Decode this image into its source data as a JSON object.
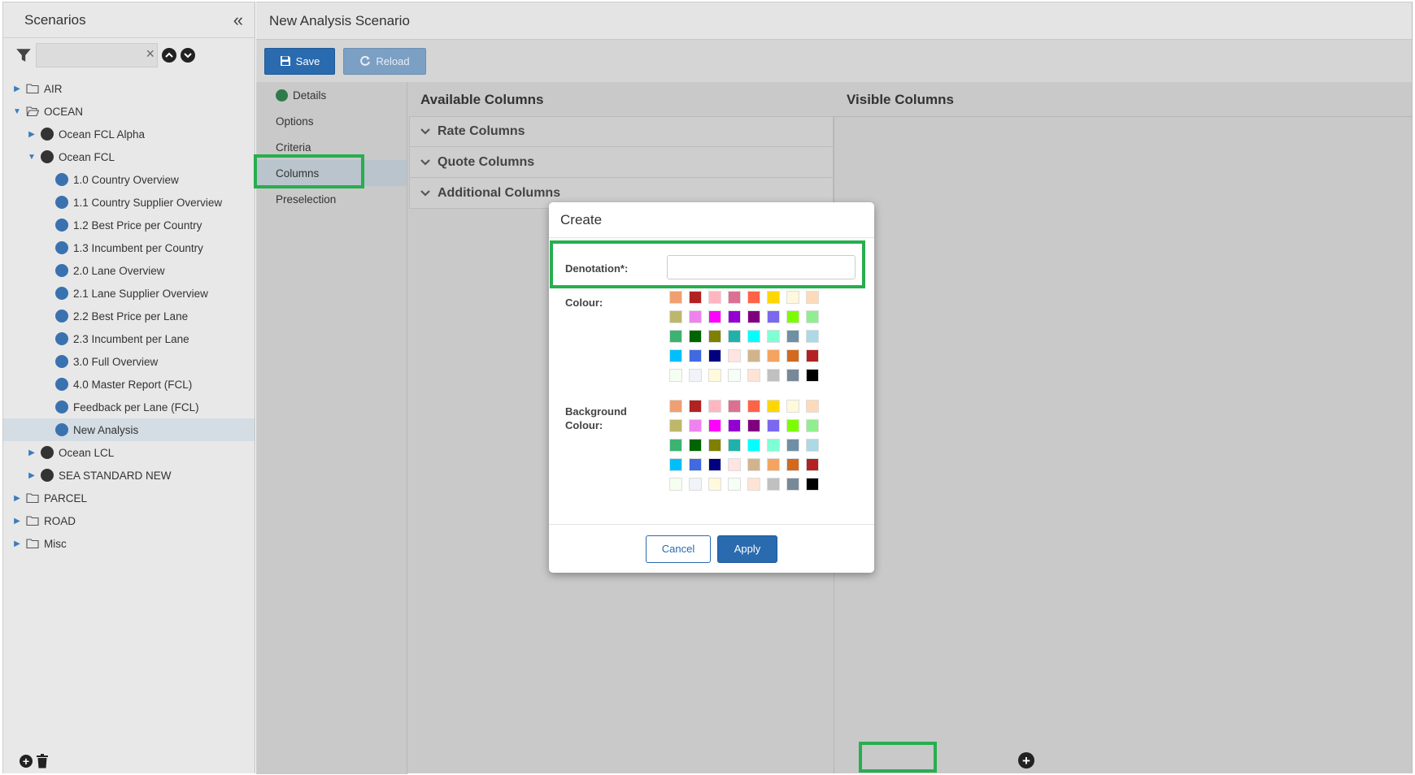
{
  "sidebar": {
    "title": "Scenarios",
    "filter_value": "",
    "tree": [
      {
        "label": "AIR",
        "level": 0,
        "kind": "folder",
        "expanded": false
      },
      {
        "label": "OCEAN",
        "level": 0,
        "kind": "folder-open",
        "expanded": true
      },
      {
        "label": "Ocean FCL Alpha",
        "level": 1,
        "kind": "dark",
        "expanded": false
      },
      {
        "label": "Ocean FCL",
        "level": 1,
        "kind": "dark",
        "expanded": true
      },
      {
        "label": "1.0 Country Overview",
        "level": 2,
        "kind": "blue"
      },
      {
        "label": "1.1 Country Supplier Overview",
        "level": 2,
        "kind": "blue"
      },
      {
        "label": "1.2 Best Price per Country",
        "level": 2,
        "kind": "blue"
      },
      {
        "label": "1.3 Incumbent per Country",
        "level": 2,
        "kind": "blue"
      },
      {
        "label": "2.0 Lane Overview",
        "level": 2,
        "kind": "blue"
      },
      {
        "label": "2.1 Lane Supplier Overview",
        "level": 2,
        "kind": "blue"
      },
      {
        "label": "2.2 Best Price per Lane",
        "level": 2,
        "kind": "blue"
      },
      {
        "label": "2.3 Incumbent per Lane",
        "level": 2,
        "kind": "blue"
      },
      {
        "label": "3.0 Full Overview",
        "level": 2,
        "kind": "blue"
      },
      {
        "label": "4.0 Master Report (FCL)",
        "level": 2,
        "kind": "blue"
      },
      {
        "label": "Feedback per Lane (FCL)",
        "level": 2,
        "kind": "blue"
      },
      {
        "label": "New Analysis",
        "level": 2,
        "kind": "blue",
        "selected": true
      },
      {
        "label": "Ocean LCL",
        "level": 1,
        "kind": "dark",
        "expanded": false
      },
      {
        "label": "SEA STANDARD NEW",
        "level": 1,
        "kind": "dark",
        "expanded": false
      },
      {
        "label": "PARCEL",
        "level": 0,
        "kind": "folder",
        "expanded": false
      },
      {
        "label": "ROAD",
        "level": 0,
        "kind": "folder",
        "expanded": false
      },
      {
        "label": "Misc",
        "level": 0,
        "kind": "folder",
        "expanded": false
      }
    ]
  },
  "main": {
    "title": "New Analysis Scenario",
    "toolbar": {
      "save_label": "Save",
      "reload_label": "Reload"
    },
    "nav": [
      "Details",
      "Options",
      "Criteria",
      "Columns",
      "Preselection"
    ],
    "active_nav": "Columns",
    "available_title": "Available Columns",
    "visible_title": "Visible Columns",
    "groups": [
      "Rate Columns",
      "Quote Columns",
      "Additional Columns"
    ]
  },
  "modal": {
    "title": "Create",
    "denotation_label": "Denotation*:",
    "denotation_value": "",
    "colour_label": "Colour:",
    "background_label_line1": "Background",
    "background_label_line2": "Colour:",
    "cancel_label": "Cancel",
    "apply_label": "Apply",
    "palette": [
      "#f0a070",
      "#b22222",
      "#ffb6c1",
      "#db7093",
      "#ff6347",
      "#ffd700",
      "#fff8dc",
      "#ffdab9",
      "#bdb76b",
      "#ee82ee",
      "#ff00ff",
      "#9400d3",
      "#800080",
      "#7b68ee",
      "#7cfc00",
      "#90ee90",
      "#3cb371",
      "#006400",
      "#808000",
      "#20b2aa",
      "#00ffff",
      "#7fffd4",
      "#6f8fa5",
      "#add8e6",
      "#00bfff",
      "#4169e1",
      "#000080",
      "#ffe4e1",
      "#d2b48c",
      "#f4a460",
      "#d2691e",
      "#b22222",
      "#f5fff0",
      "#f0f4f8",
      "#fffadc",
      "#f5fff5",
      "#ffe4d6",
      "#c0c0c0",
      "#778899",
      "#000000"
    ]
  },
  "colors": {
    "accent_blue": "#2a6aaf",
    "highlight_green": "#27ae4f",
    "status_green": "#2f7a4a",
    "node_blue": "#3a72b0"
  }
}
